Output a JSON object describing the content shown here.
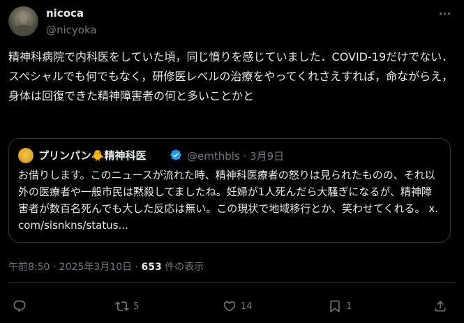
{
  "author": {
    "name": "nicoca",
    "handle": "@nicyoka"
  },
  "tweet": {
    "text": "精神科病院で内科医をしていた頃，同じ憤りを感じていました．COVID-19だけでない．スペシャルでも何でもなく，研修医レベルの治療をやってくれさえすれば，命ながらえ，身体は回復できた精神障害者の何と多いことかと"
  },
  "quote": {
    "name": "プリンパン",
    "name_emoji": "🐥",
    "name_suffix": "精神科医",
    "handle_date": "@emthbls · 3月9日",
    "text": "お借りします。このニュースが流れた時、精神科医療者の怒りは見られたものの、それ以外の医療者や一般市民は黙殺してましたね。妊婦が1人死んだら大騒ぎになるが、精神障害者が数百名死んでも大した反応は無い。この現状で地域移行とか、笑わせてくれる。 ",
    "link": "x.com/sisnkns/status..."
  },
  "meta": {
    "time_date": "午前8:50 · 2025年3月10日 · ",
    "views": "653",
    "views_label": " 件の表示"
  },
  "actions": {
    "reply_count": "",
    "retweet_count": "5",
    "like_count": "14",
    "bookmark_count": "1"
  },
  "colors": {
    "background": "#000000",
    "text": "#e7e9ea",
    "secondary": "#71767b",
    "border": "#2f3336",
    "verified": "#1d9bf0"
  },
  "icons": [
    "more-icon",
    "verified-icon",
    "reply-icon",
    "retweet-icon",
    "like-icon",
    "bookmark-icon",
    "share-icon"
  ]
}
